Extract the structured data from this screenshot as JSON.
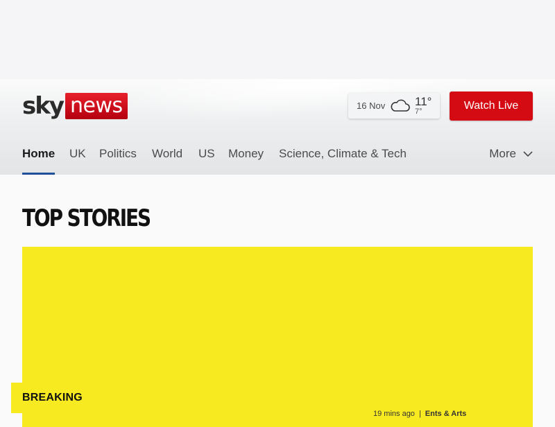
{
  "logo": {
    "sky": "sky",
    "news": "news"
  },
  "weather": {
    "date": "16 Nov",
    "icon": "cloud-icon",
    "high": "11°",
    "low": "7°"
  },
  "header": {
    "watch_live_label": "Watch Live"
  },
  "nav": {
    "items": [
      {
        "label": "Home",
        "active": true
      },
      {
        "label": "UK"
      },
      {
        "label": "Politics"
      },
      {
        "label": "World"
      },
      {
        "label": "US"
      },
      {
        "label": "Money"
      },
      {
        "label": "Science, Climate & Tech"
      }
    ],
    "more_label": "More"
  },
  "main": {
    "section_title": "TOP STORIES",
    "hero": {
      "badge": "BREAKING",
      "time": "19 mins ago",
      "separator": "|",
      "category": "Ents & Arts"
    }
  },
  "colors": {
    "brand_red": "#d40b12",
    "breaking_yellow": "#f8ea20",
    "nav_active_underline": "#1f4f9a"
  }
}
